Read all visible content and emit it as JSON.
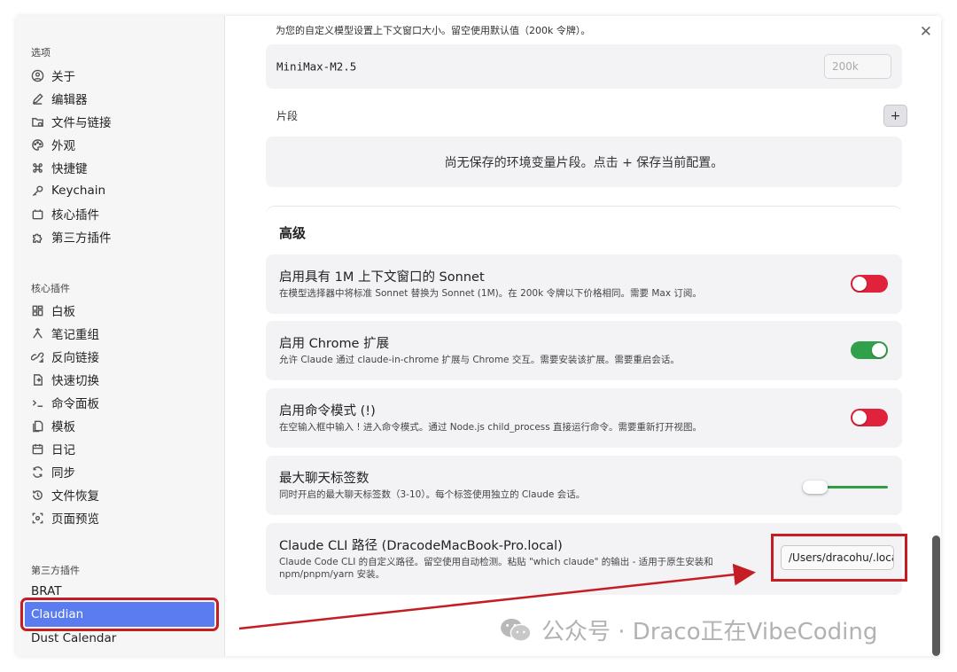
{
  "sidebar": {
    "options_title": "选项",
    "options": [
      {
        "label": "关于",
        "icon": "info-circle-icon"
      },
      {
        "label": "编辑器",
        "icon": "pencil-icon"
      },
      {
        "label": "文件与链接",
        "icon": "folder-link-icon"
      },
      {
        "label": "外观",
        "icon": "palette-icon"
      },
      {
        "label": "快捷键",
        "icon": "command-icon"
      },
      {
        "label": "Keychain",
        "icon": "key-icon"
      },
      {
        "label": "核心插件",
        "icon": "plugin-icon"
      },
      {
        "label": "第三方插件",
        "icon": "puzzle-icon"
      }
    ],
    "core_title": "核心插件",
    "core_plugins": [
      {
        "label": "白板",
        "icon": "grid-icon"
      },
      {
        "label": "笔记重组",
        "icon": "merge-icon"
      },
      {
        "label": "反向链接",
        "icon": "backlink-icon"
      },
      {
        "label": "快速切换",
        "icon": "switch-icon"
      },
      {
        "label": "命令面板",
        "icon": "terminal-icon"
      },
      {
        "label": "模板",
        "icon": "template-icon"
      },
      {
        "label": "日记",
        "icon": "calendar-icon"
      },
      {
        "label": "同步",
        "icon": "sync-icon"
      },
      {
        "label": "文件恢复",
        "icon": "history-icon"
      },
      {
        "label": "页面预览",
        "icon": "preview-icon"
      }
    ],
    "third_title": "第三方插件",
    "third_plugins": [
      "BRAT",
      "Claudian",
      "Dust Calendar"
    ]
  },
  "main": {
    "top_desc": "为您的自定义模型设置上下文窗口大小。留空使用默认值（200k 令牌）。",
    "model_name": "MiniMax-M2.5",
    "model_placeholder": "200k",
    "snippets_label": "片段",
    "add_label": "+",
    "snippets_empty": "尚无保存的环境变量片段。点击 + 保存当前配置。",
    "advanced_title": "高级",
    "settings": [
      {
        "title": "启用具有 1M 上下文窗口的 Sonnet",
        "desc": "在模型选择器中将标准 Sonnet 替换为 Sonnet (1M)。在 200k 令牌以下价格相同。需要 Max 订阅。",
        "state": "off"
      },
      {
        "title": "启用 Chrome 扩展",
        "desc": "允许 Claude 通过 claude-in-chrome 扩展与 Chrome 交互。需要安装该扩展。需要重启会话。",
        "state": "on"
      },
      {
        "title": "启用命令模式 (!)",
        "desc": "在空输入框中输入 ! 进入命令模式。通过 Node.js child_process 直接运行命令。需要重新打开视图。",
        "state": "off"
      },
      {
        "title": "最大聊天标签数",
        "desc": "同时开启的最大聊天标签数（3-10）。每个标签使用独立的 Claude 会话。",
        "slider_fraction": 0.0
      }
    ],
    "cli": {
      "title": "Claude CLI 路径 (DracodeMacBook-Pro.local)",
      "desc_line1": "Claude Code CLI 的自定义路径。留空使用自动检测。粘贴 \"which claude\" 的输出 - 适用于原生安装和",
      "desc_line2": "npm/pnpm/yarn 安装。",
      "value": "/Users/dracohu/.local/bin/claude"
    },
    "close_label": "✕"
  },
  "watermark": "公众号 · Draco正在VibeCoding",
  "colors": {
    "accent": "#5b7cf0",
    "annotation_red": "#c41e24",
    "toggle_off": "#e0223d",
    "toggle_on": "#31a04a"
  }
}
